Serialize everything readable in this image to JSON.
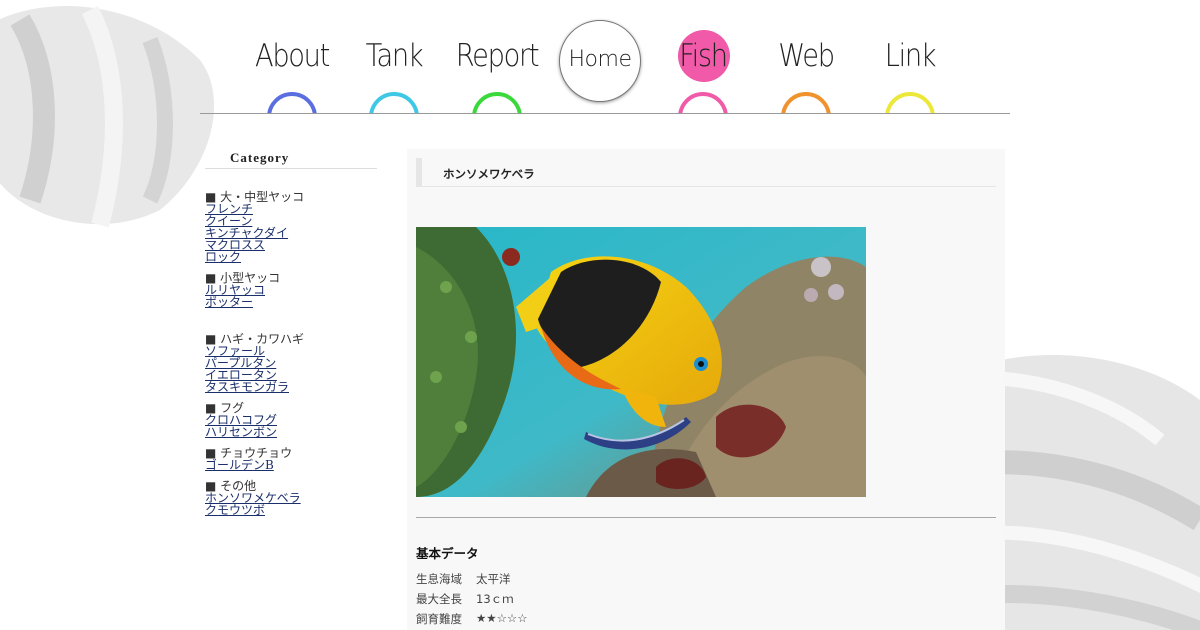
{
  "nav": {
    "items": [
      {
        "label": "About",
        "color": "#5b6ee0"
      },
      {
        "label": "Tank",
        "color": "#3ec8e6"
      },
      {
        "label": "Report",
        "color": "#3bd83b"
      },
      {
        "label": "Home",
        "color": "#888888"
      },
      {
        "label": "Fish",
        "color": "#f05aa8"
      },
      {
        "label": "Web",
        "color": "#f0922e"
      },
      {
        "label": "Link",
        "color": "#ece83a"
      }
    ]
  },
  "sidebar": {
    "title": "Category",
    "groups": [
      {
        "head": "■ 大・中型ヤッコ",
        "links": [
          "フレンチ",
          "クイーン",
          "キンチャクダイ",
          "マクロスス",
          "ロック"
        ]
      },
      {
        "head": "■ 小型ヤッコ",
        "links": [
          "ルリヤッコ",
          "ポッター"
        ]
      },
      {
        "head": "■ ハギ・カワハギ",
        "links": [
          "ソファール",
          "パープルタン",
          "イエロータン",
          "タスキモンガラ"
        ]
      },
      {
        "head": "■ フグ",
        "links": [
          "クロハコフグ",
          "ハリセンボン"
        ]
      },
      {
        "head": "■ チョウチョウ",
        "links": [
          "ゴールデンB"
        ]
      },
      {
        "head": "■ その他",
        "links": [
          "ホンソワメケベラ",
          "クモウツボ"
        ]
      }
    ]
  },
  "post": {
    "title": "ホンソメワケベラ",
    "data_heading": "基本データ",
    "rows": [
      {
        "key": "生息海域",
        "value": "太平洋"
      },
      {
        "key": "最大全長",
        "value": "13ｃｍ"
      },
      {
        "key": "飼育難度",
        "value": "★★☆☆☆"
      }
    ]
  },
  "colors": {
    "fish_highlight": "#f05aa8",
    "link": "#1a2f6b"
  }
}
